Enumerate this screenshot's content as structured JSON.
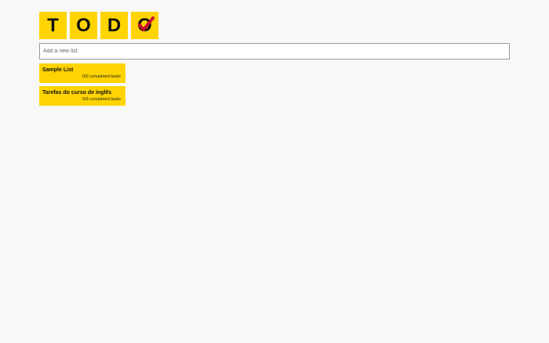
{
  "logo": {
    "letters": [
      "T",
      "O",
      "D",
      "O"
    ],
    "check_icon": "checkmark-icon",
    "tile_color": "#ffd400",
    "check_color": "#c8102e"
  },
  "new_list_input": {
    "placeholder": "Add a new list",
    "value": ""
  },
  "lists": [
    {
      "name": "Sample List",
      "completed": "0/0",
      "progress_suffix": "completed tasks"
    },
    {
      "name": "Tarefas do curso de inglês",
      "completed": "0/3",
      "progress_suffix": "completed tasks"
    }
  ]
}
